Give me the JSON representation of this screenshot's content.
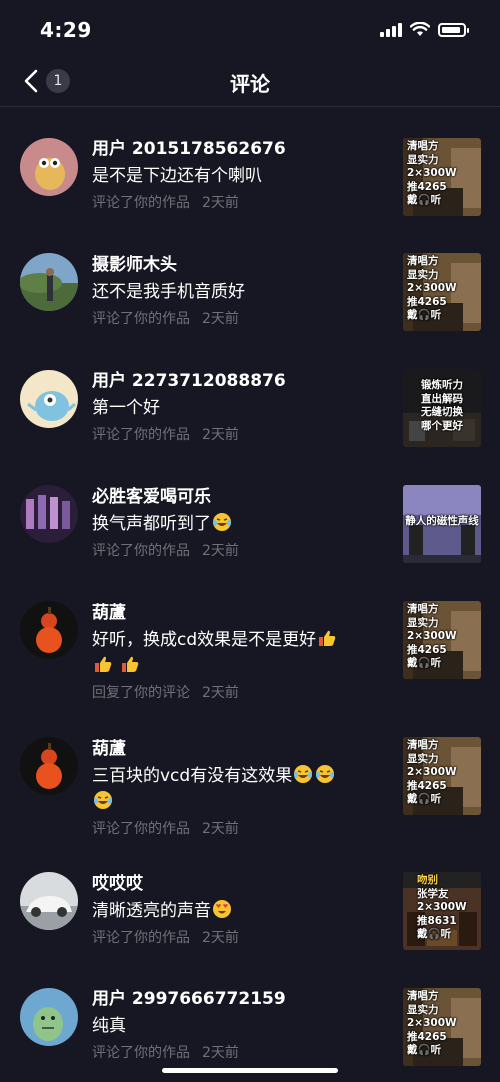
{
  "status": {
    "time": "4:29"
  },
  "nav": {
    "title": "评论",
    "badge": "1"
  },
  "comments": [
    {
      "user": "用户 2015178562676",
      "text": "是不是下边还有个喇叭",
      "action": "评论了你的作品",
      "time": "2天前",
      "thumb": [
        "清唱方",
        "显实力",
        "2×300W",
        "推4265",
        "戴🎧听"
      ]
    },
    {
      "user": "摄影师木头",
      "text": "还不是我手机音质好",
      "action": "评论了你的作品",
      "time": "2天前",
      "thumb": [
        "清唱方",
        "显实力",
        "2×300W",
        "推4265",
        "戴🎧听"
      ]
    },
    {
      "user": "用户 2273712088876",
      "text": "第一个好",
      "action": "评论了你的作品",
      "time": "2天前",
      "thumb": [
        "锻炼听力",
        "直出解码",
        "无缝切换",
        "哪个更好"
      ]
    },
    {
      "user": "必胜客爱喝可乐",
      "text": "换气声都听到了",
      "action": "评论了你的作品",
      "time": "2天前",
      "thumb": [
        "静人的磁性声线"
      ]
    },
    {
      "user": "葫蘆",
      "text": "好听，换成cd效果是不是更好",
      "action": "回复了你的评论",
      "time": "2天前",
      "thumb": [
        "清唱方",
        "显实力",
        "2×300W",
        "推4265",
        "戴🎧听"
      ]
    },
    {
      "user": "葫蘆",
      "text": "三百块的vcd有没有这效果",
      "action": "评论了你的作品",
      "time": "2天前",
      "thumb": [
        "清唱方",
        "显实力",
        "2×300W",
        "推4265",
        "戴🎧听"
      ]
    },
    {
      "user": "哎哎哎",
      "text": "清晰透亮的声音",
      "action": "评论了你的作品",
      "time": "2天前",
      "thumb": [
        "吻别",
        "张学友",
        "2×300W",
        "推8631",
        "戴🎧听"
      ]
    },
    {
      "user": "用户 2997666772159",
      "text": "纯真",
      "action": "评论了你的作品",
      "time": "2天前",
      "thumb": [
        "清唱方",
        "显实力",
        "2×300W",
        "推4265",
        "戴🎧听"
      ]
    }
  ]
}
